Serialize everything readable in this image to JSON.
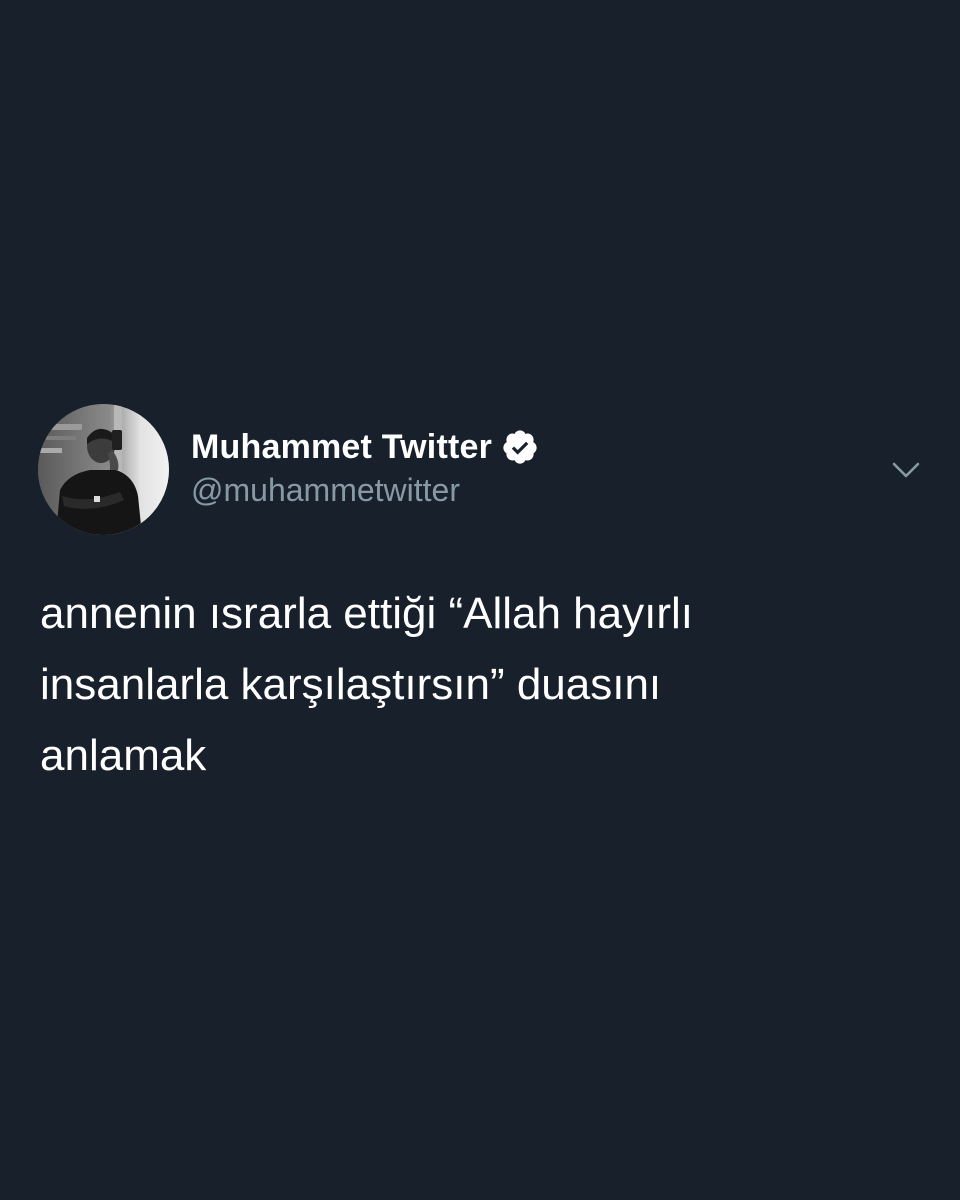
{
  "tweet": {
    "author": {
      "display_name": "Muhammet Twitter",
      "handle": "@muhammetwitter",
      "verified": true,
      "verified_icon": "verified-badge-icon",
      "avatar": "profile-photo (grayscale, person in black t-shirt)"
    },
    "menu_icon": "chevron-down-icon",
    "text_lines": [
      "annenin ısrarla ettiği “Allah hayırlı",
      "insanlarla karşılaştırsın” duasını",
      "anlamak"
    ]
  },
  "colors": {
    "background": "#18202b",
    "primary_text": "#ffffff",
    "secondary_text": "#8899a6",
    "chevron": "#8899a6"
  }
}
